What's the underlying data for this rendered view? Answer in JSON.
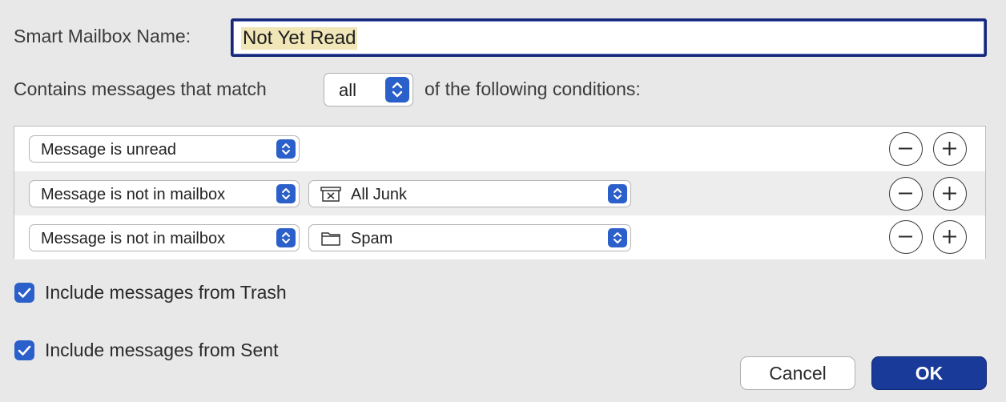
{
  "name_row": {
    "label": "Smart Mailbox Name:",
    "value": "Not Yet Read"
  },
  "match_row": {
    "prefix": "Contains messages that match",
    "selected": "all",
    "suffix": "of the following conditions:"
  },
  "conditions": [
    {
      "field": "Message is unread"
    },
    {
      "field": "Message is not in mailbox",
      "mailbox": "All Junk",
      "mailbox_icon": "junk-box-icon"
    },
    {
      "field": "Message is not in mailbox",
      "mailbox": "Spam",
      "mailbox_icon": "folder-icon"
    }
  ],
  "options": {
    "include_trash": {
      "label": "Include messages from Trash",
      "checked": true
    },
    "include_sent": {
      "label": "Include messages from Sent",
      "checked": true
    }
  },
  "buttons": {
    "cancel": "Cancel",
    "ok": "OK"
  },
  "colors": {
    "accent": "#2b5fc9",
    "default_button": "#1a3a9a",
    "focus_ring": "#16277a"
  }
}
